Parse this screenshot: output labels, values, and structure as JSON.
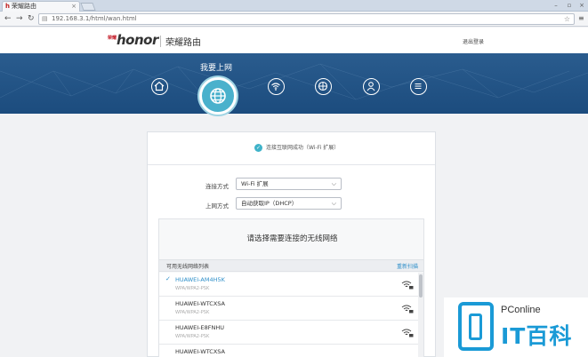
{
  "browser": {
    "tab_title": "荣耀路由",
    "url": "192.168.3.1/html/wan.html"
  },
  "header": {
    "logo_small": "荣耀",
    "logo_text": "honor",
    "brand_cn": "荣耀路由",
    "exit_label": "退出登录"
  },
  "banner": {
    "title": "我要上网",
    "nav_icons": [
      "home-icon",
      "globe-icon",
      "wifi-icon",
      "network-icon",
      "user-icon",
      "menu-icon"
    ]
  },
  "status": {
    "text": "连接互联网成功（Wi-Fi 扩展）"
  },
  "form": {
    "connect_label": "连接方式",
    "connect_value": "Wi-Fi 扩展",
    "internet_label": "上网方式",
    "internet_value": "自动获取IP（DHCP）"
  },
  "network_list": {
    "prompt": "请选择需要连接的无线网络",
    "header_label": "可用无线网络列表",
    "rescan_label": "重新扫描",
    "items": [
      {
        "ssid": "HUAWEI-AM4H5K",
        "security": "WPA/WPA2-PSK",
        "selected": true
      },
      {
        "ssid": "HUAWEI-WTCXSA",
        "security": "WPA/WPA2-PSK",
        "selected": false
      },
      {
        "ssid": "HUAWEI-E8FNHU",
        "security": "WPA/WPA2-PSK",
        "selected": false
      },
      {
        "ssid": "HUAWEI-WTCXSA",
        "security": "",
        "selected": false
      }
    ]
  },
  "watermark": {
    "brand": "PConline",
    "text": "IT百科"
  },
  "colors": {
    "banner": "#1f4f82",
    "accent": "#3fb3c9",
    "link": "#2e8fc9"
  }
}
